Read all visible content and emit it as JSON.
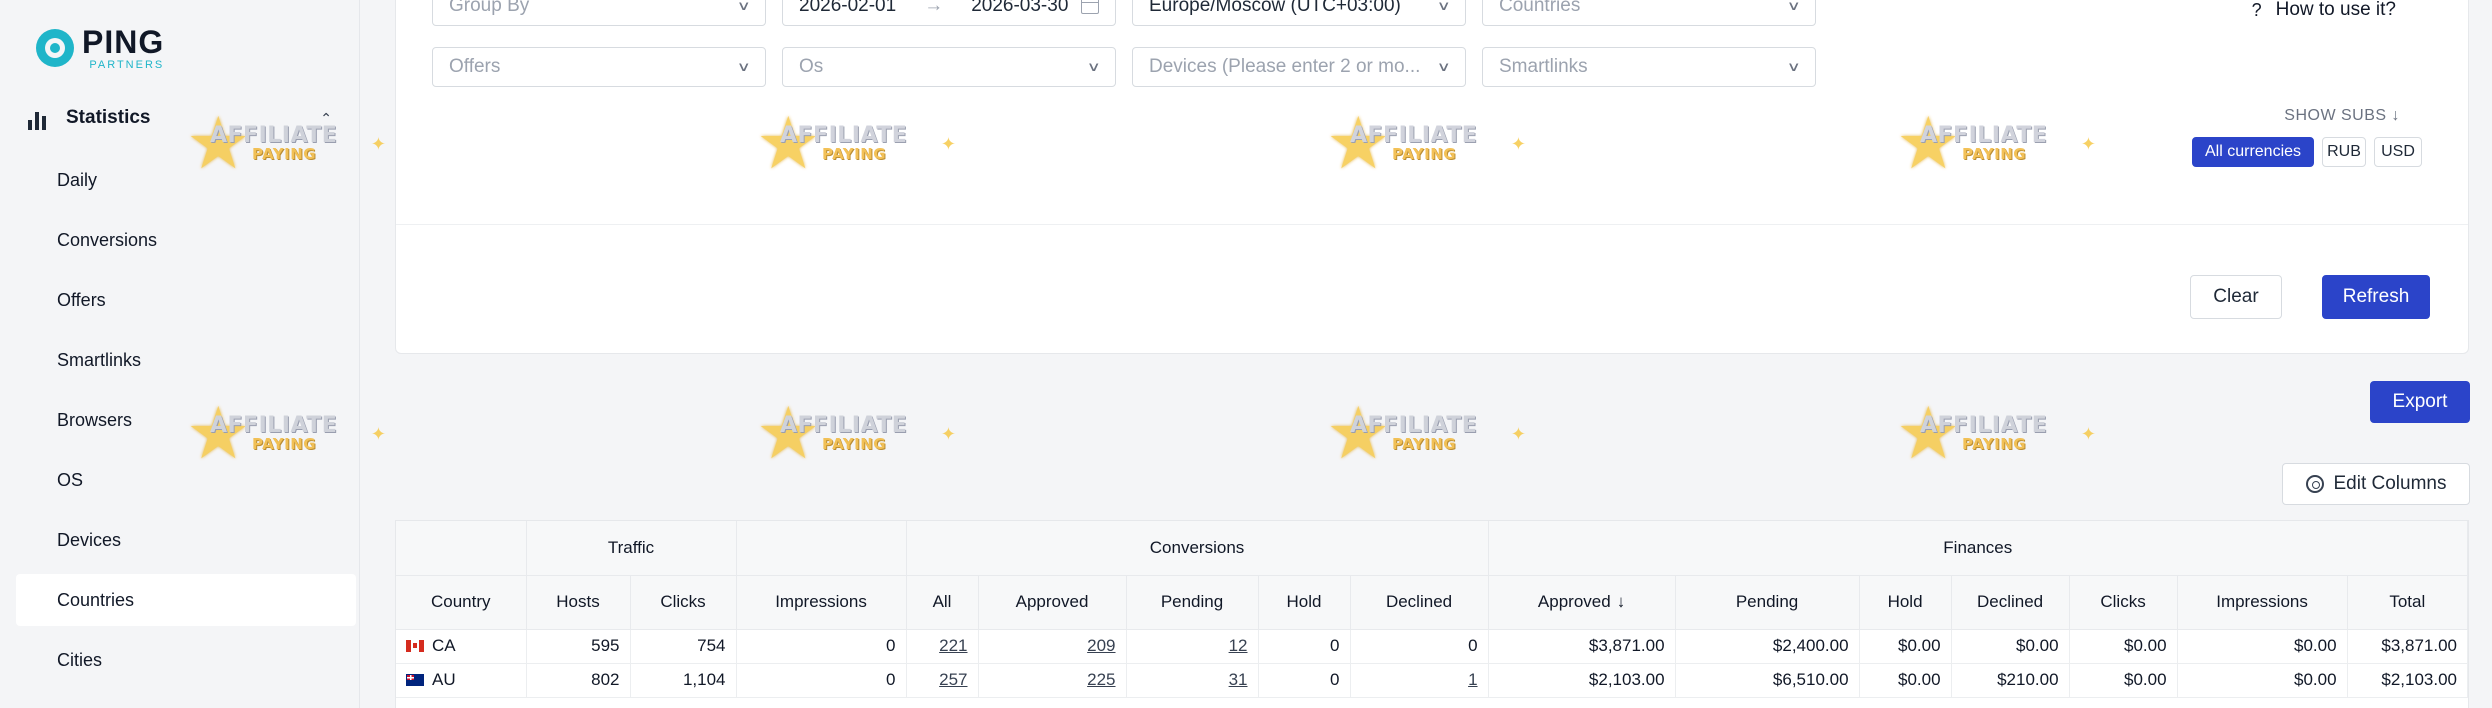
{
  "logo": {
    "main": "PING",
    "sub": "PARTNERS"
  },
  "sidebar": {
    "section": {
      "label": "Statistics",
      "icon": "bar-chart-icon",
      "expanded": true
    },
    "items": [
      {
        "label": "Daily"
      },
      {
        "label": "Conversions"
      },
      {
        "label": "Offers"
      },
      {
        "label": "Smartlinks"
      },
      {
        "label": "Browsers"
      },
      {
        "label": "OS"
      },
      {
        "label": "Devices"
      },
      {
        "label": "Countries",
        "active": true
      },
      {
        "label": "Cities"
      }
    ]
  },
  "filters": {
    "group_by": {
      "placeholder": "Group By"
    },
    "date_from": "2026-02-01",
    "date_to": "2026-03-30",
    "timezone": "Europe/Moscow (UTC+03:00)",
    "countries": {
      "placeholder": "Countries"
    },
    "offers": {
      "placeholder": "Offers"
    },
    "os": {
      "placeholder": "Os"
    },
    "devices": {
      "placeholder": "Devices (Please enter 2 or mo..."
    },
    "smartlinks": {
      "placeholder": "Smartlinks"
    },
    "arrow": "→"
  },
  "help": {
    "icon": "?",
    "label": "How to use it?"
  },
  "subs": {
    "label": "SHOW SUBS ↓"
  },
  "currencies": {
    "options": [
      "All currencies",
      "RUB",
      "USD"
    ],
    "selected": "All currencies"
  },
  "actions": {
    "clear": "Clear",
    "refresh": "Refresh",
    "export": "Export",
    "edit_columns": "Edit Columns"
  },
  "watermark": {
    "line1": "AFFILIATE",
    "line2": "PAYING"
  },
  "table": {
    "groups": {
      "traffic": "Traffic",
      "conversions": "Conversions",
      "finances": "Finances"
    },
    "columns": {
      "country": "Country",
      "hosts": "Hosts",
      "clicks": "Clicks",
      "impressions": "Impressions",
      "conv_all": "All",
      "conv_approved": "Approved",
      "conv_pending": "Pending",
      "conv_hold": "Hold",
      "conv_declined": "Declined",
      "fin_approved": "Approved",
      "fin_pending": "Pending",
      "fin_hold": "Hold",
      "fin_declined": "Declined",
      "fin_clicks": "Clicks",
      "fin_impressions": "Impressions",
      "fin_total": "Total"
    },
    "sort_indicator": "↓",
    "rows": [
      {
        "country": "CA",
        "flag": "flag-ca",
        "hosts": "595",
        "clicks": "754",
        "impressions": "0",
        "conv_all": "221",
        "conv_approved": "209",
        "conv_pending": "12",
        "conv_hold": "0",
        "conv_declined": "0",
        "fin_approved": "$3,871.00",
        "fin_pending": "$2,400.00",
        "fin_hold": "$0.00",
        "fin_declined": "$0.00",
        "fin_clicks": "$0.00",
        "fin_impressions": "$0.00",
        "fin_total": "$3,871.00"
      },
      {
        "country": "AU",
        "flag": "flag-au",
        "hosts": "802",
        "clicks": "1,104",
        "impressions": "0",
        "conv_all": "257",
        "conv_approved": "225",
        "conv_pending": "31",
        "conv_hold": "0",
        "conv_declined": "1",
        "fin_approved": "$2,103.00",
        "fin_pending": "$6,510.00",
        "fin_hold": "$0.00",
        "fin_declined": "$210.00",
        "fin_clicks": "$0.00",
        "fin_impressions": "$0.00",
        "fin_total": "$2,103.00"
      }
    ]
  }
}
